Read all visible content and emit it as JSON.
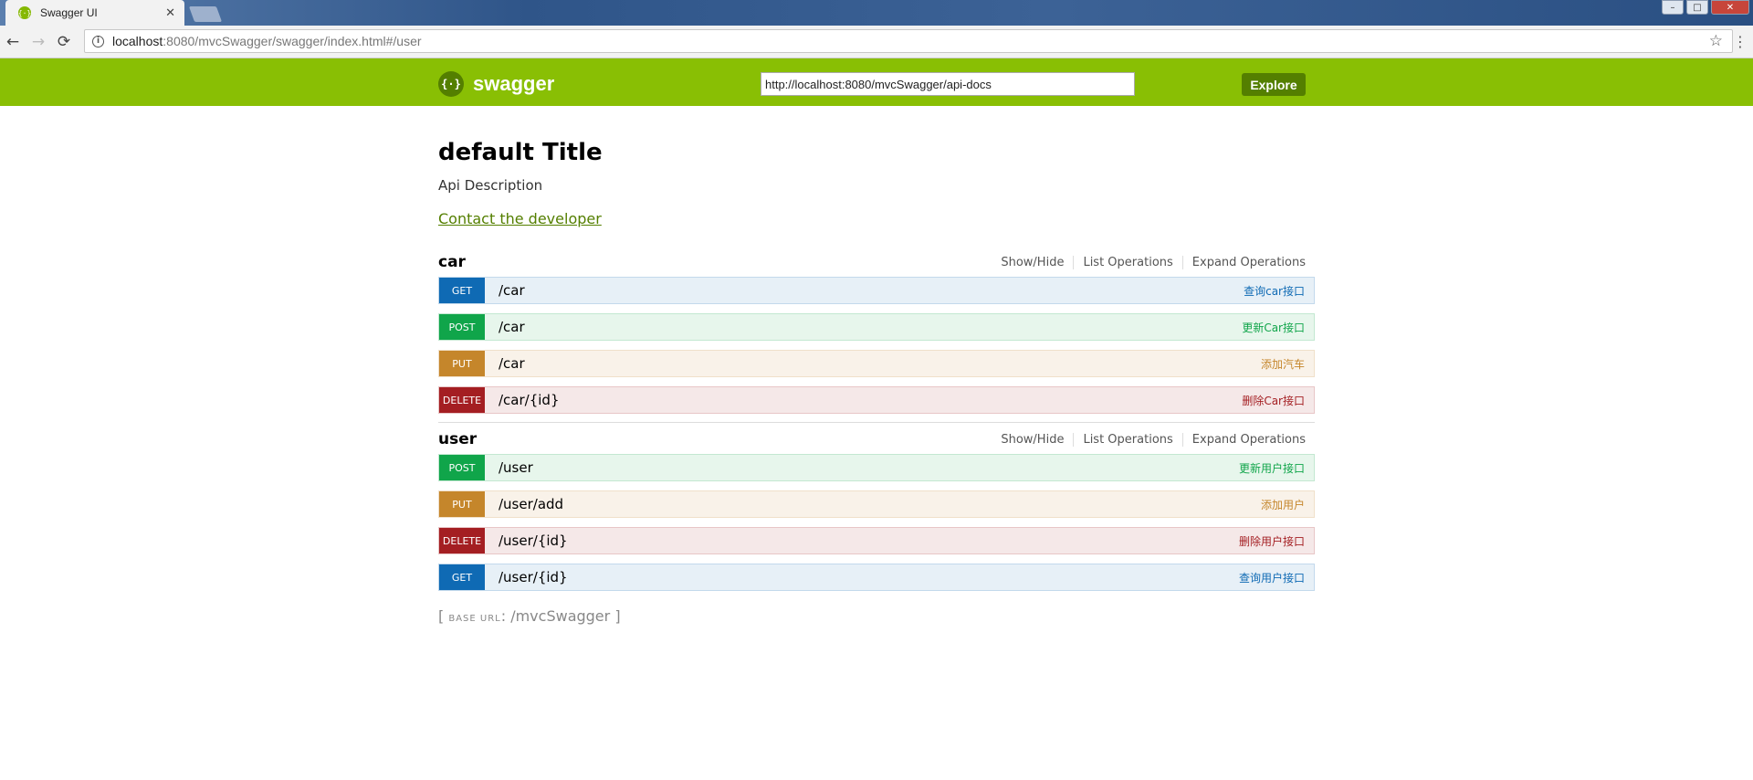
{
  "browser": {
    "tab_title": "Swagger UI",
    "tab_close": "✕",
    "favicon": "{·}",
    "url_host": "localhost",
    "url_rest": ":8080/mvcSwagger/swagger/index.html#/user",
    "back": "←",
    "forward": "→",
    "reload": "⟳",
    "star": "☆",
    "menu": "⋮",
    "win_min": "–",
    "win_max": "□",
    "win_close": "✕"
  },
  "header": {
    "logo_glyph": "{·}",
    "logo_text": "swagger",
    "api_url": "http://localhost:8080/mvcSwagger/api-docs",
    "explore_label": "Explore"
  },
  "info": {
    "title": "default Title",
    "description": "Api Description",
    "contact_label": "Contact the developer"
  },
  "resource_ops": {
    "show_hide": "Show/Hide",
    "list": "List Operations",
    "expand": "Expand Operations"
  },
  "resources": [
    {
      "name": "car",
      "operations": [
        {
          "method": "GET",
          "path": "/car",
          "summary": "查询car接口"
        },
        {
          "method": "POST",
          "path": "/car",
          "summary": "更新Car接口"
        },
        {
          "method": "PUT",
          "path": "/car",
          "summary": "添加汽车"
        },
        {
          "method": "DELETE",
          "path": "/car/{id}",
          "summary": "删除Car接口"
        }
      ]
    },
    {
      "name": "user",
      "operations": [
        {
          "method": "POST",
          "path": "/user",
          "summary": "更新用户接口"
        },
        {
          "method": "PUT",
          "path": "/user/add",
          "summary": "添加用户"
        },
        {
          "method": "DELETE",
          "path": "/user/{id}",
          "summary": "删除用户接口"
        },
        {
          "method": "GET",
          "path": "/user/{id}",
          "summary": "查询用户接口"
        }
      ]
    }
  ],
  "footer": {
    "open": "[ ",
    "label": "BASE URL",
    "sep": ": ",
    "value": "/mvcSwagger",
    "close": " ]"
  },
  "colors": {
    "header_bg": "#89bf04",
    "get": "#0f6ab4",
    "post": "#10a54a",
    "put": "#c5862b",
    "delete": "#a41e22"
  }
}
